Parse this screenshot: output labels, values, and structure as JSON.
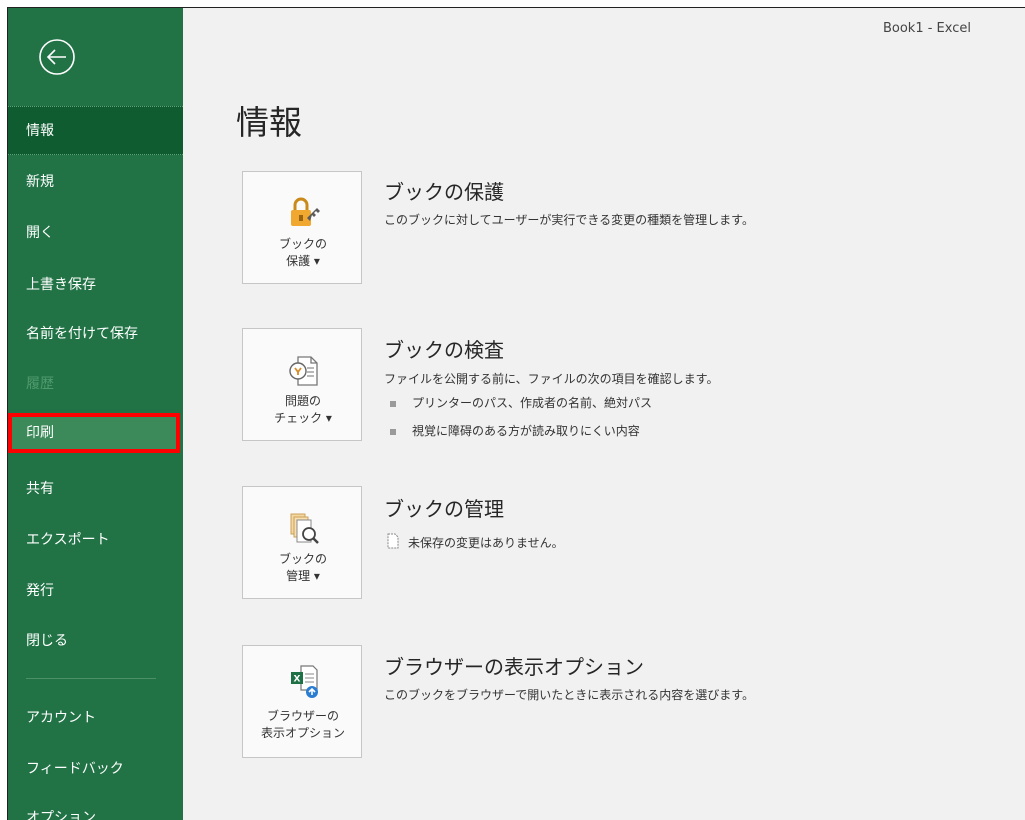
{
  "window": {
    "title": "Book1  -  Excel"
  },
  "sidebar": {
    "items": [
      {
        "label": "情報"
      },
      {
        "label": "新規"
      },
      {
        "label": "開く"
      },
      {
        "label": "上書き保存"
      },
      {
        "label": "名前を付けて保存"
      },
      {
        "label": "履歴"
      },
      {
        "label": "印刷"
      },
      {
        "label": "共有"
      },
      {
        "label": "エクスポート"
      },
      {
        "label": "発行"
      },
      {
        "label": "閉じる"
      },
      {
        "label": "アカウント"
      },
      {
        "label": "フィードバック"
      },
      {
        "label": "オプション"
      }
    ]
  },
  "main": {
    "title": "情報",
    "sections": [
      {
        "button": {
          "line1": "ブックの",
          "line2": "保護 ▾"
        },
        "title": "ブックの保護",
        "desc": "このブックに対してユーザーが実行できる変更の種類を管理します。"
      },
      {
        "button": {
          "line1": "問題の",
          "line2": "チェック ▾"
        },
        "title": "ブックの検査",
        "desc": "ファイルを公開する前に、ファイルの次の項目を確認します。",
        "bullets": [
          "プリンターのパス、作成者の名前、絶対パス",
          "視覚に障碍のある方が読み取りにくい内容"
        ]
      },
      {
        "button": {
          "line1": "ブックの",
          "line2": "管理 ▾"
        },
        "title": "ブックの管理",
        "desc": "未保存の変更はありません。"
      },
      {
        "button": {
          "line1": "ブラウザーの",
          "line2": "表示オプション"
        },
        "title": "ブラウザーの表示オプション",
        "desc": "このブックをブラウザーで開いたときに表示される内容を選びます。"
      }
    ]
  },
  "colors": {
    "sidebar_bg": "#217346",
    "sidebar_active": "#0e5c30",
    "highlight": "#ff0000",
    "content_bg": "#f1f1f1"
  }
}
